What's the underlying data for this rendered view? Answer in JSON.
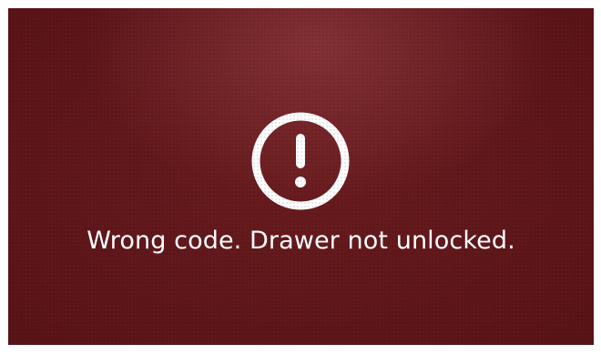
{
  "screen": {
    "background_color": "#5a1418",
    "icon": "exclamation-circle-icon",
    "icon_color": "#ffffff",
    "message": "Wrong code. Drawer not unlocked."
  }
}
